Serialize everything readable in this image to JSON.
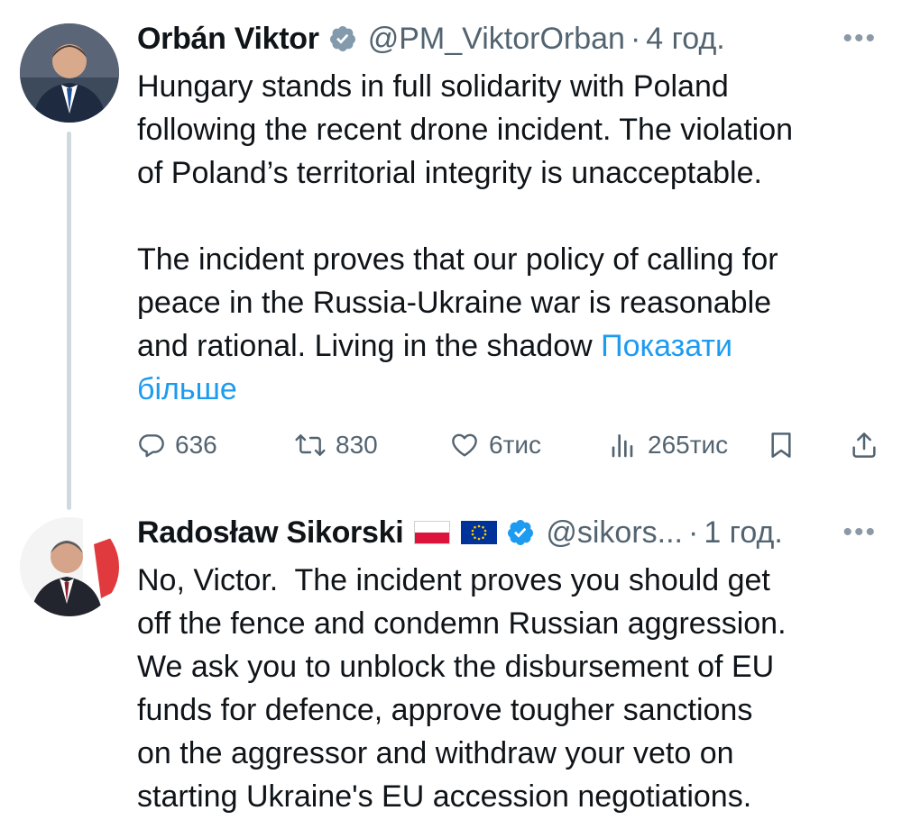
{
  "tweets": [
    {
      "author": {
        "name": "Orbán Viktor",
        "handle": "@PM_ViktorOrban",
        "verified": true
      },
      "separator": "·",
      "time": "4 год.",
      "more_icon": "more-horizontal-icon",
      "text": "Hungary stands in full solidarity with Poland\nfollowing the recent drone incident. The violation\nof Poland’s territorial integrity is unacceptable.\n\nThe incident proves that our policy of calling for\npeace in the Russia-Ukraine war is reasonable\nand rational. Living in the shadow ",
      "show_more": "Показати\nбільше",
      "stats": {
        "replies": "636",
        "retweets": "830",
        "likes": "6тис",
        "views": "265тис"
      }
    },
    {
      "author": {
        "name": "Radosław Sikorski",
        "flags": [
          "poland-flag",
          "eu-flag"
        ],
        "handle": "@sikors...",
        "verified": true
      },
      "separator": "·",
      "time": "1 год.",
      "more_icon": "more-horizontal-icon",
      "text": "No, Victor.  The incident proves you should get\noff the fence and condemn Russian aggression.\nWe ask you to unblock the disbursement of EU\nfunds for defence, approve tougher sanctions\non the aggressor and withdraw your veto on\nstarting Ukraine's EU accession negotiations."
    }
  ],
  "colors": {
    "text": "#0f1419",
    "secondary": "#536471",
    "link": "#1d9bf0",
    "verified": "#1d9bf0",
    "thread_line": "#cfd9de"
  }
}
